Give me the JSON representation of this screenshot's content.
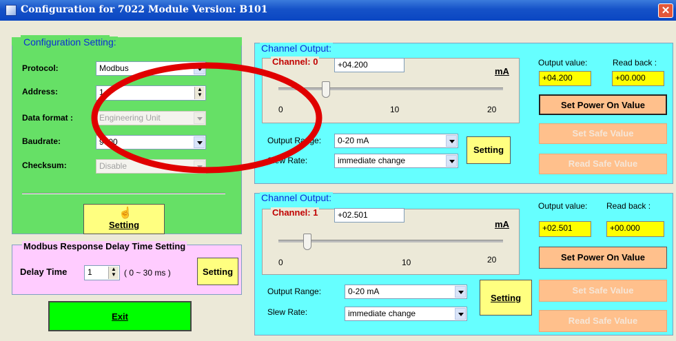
{
  "window": {
    "title": "Configuration for 7022 Module Version: B101"
  },
  "config": {
    "legend": "Configuration Setting:",
    "protocol_label": "Protocol:",
    "protocol_value": "Modbus",
    "address_label": "Address:",
    "address_value": "1",
    "dataformat_label": "Data format :",
    "dataformat_value": "Engineering Unit",
    "baudrate_label": "Baudrate:",
    "baudrate_value": "9600",
    "checksum_label": "Checksum:",
    "checksum_value": "Disable",
    "setting_button": "Setting"
  },
  "delay": {
    "legend": "Modbus Response Delay Time Setting",
    "label": "Delay Time",
    "value": "1",
    "range": "( 0 ~ 30 ms )",
    "setting_button": "Setting"
  },
  "exit_button": "Exit",
  "channels": [
    {
      "legend": "Channel Output:",
      "channel_label": "Channel: 0",
      "value": "+04.200",
      "unit": "mA",
      "slider_level_ma": 4.2,
      "scale": [
        "0",
        "10",
        "20"
      ],
      "output_range_label": "Output Range:",
      "output_range_value": "0-20 mA",
      "slew_rate_label": "Slew Rate:",
      "slew_rate_value": "immediate change",
      "setting_button": "Setting",
      "output_value_label": "Output value:",
      "read_back_label": "Read back :",
      "output_value": "+04.200",
      "read_back": "+00.000",
      "set_power_on_button": "Set Power On Value",
      "set_safe_button": "Set Safe Value",
      "read_safe_button": "Read Safe Value"
    },
    {
      "legend": "Channel Output:",
      "channel_label": "Channel: 1",
      "value": "+02.501",
      "unit": "mA",
      "slider_level_ma": 2.5,
      "scale": [
        "0",
        "10",
        "20"
      ],
      "output_range_label": "Output Range:",
      "output_range_value": "0-20 mA",
      "slew_rate_label": "Slew Rate:",
      "slew_rate_value": "immediate change",
      "setting_button": "Setting",
      "output_value_label": "Output value:",
      "read_back_label": "Read back :",
      "output_value": "+02.501",
      "read_back": "+00.000",
      "set_power_on_button": "Set Power On Value",
      "set_safe_button": "Set Safe Value",
      "read_safe_button": "Read Safe Value"
    }
  ],
  "colors": {
    "config_panel": "#66e066",
    "channel_panel": "#66ffff",
    "delay_panel": "#ffccff",
    "highlight_ellipse": "#e00000"
  }
}
